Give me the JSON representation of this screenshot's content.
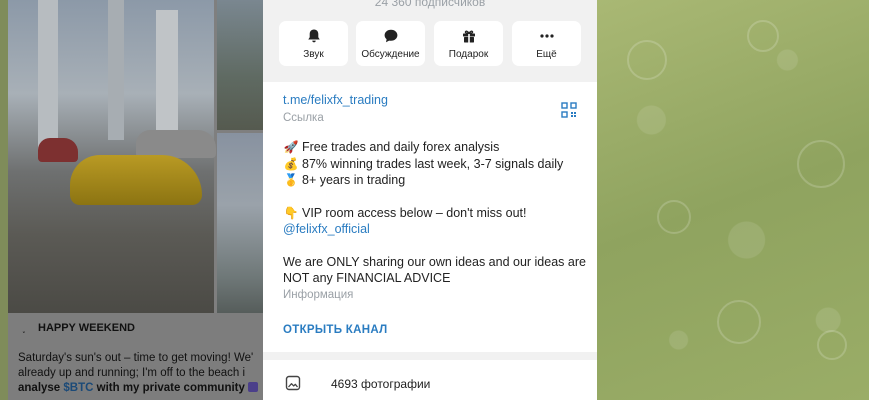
{
  "channel": {
    "subscribers": "24 360 подписчиков",
    "actions": [
      {
        "label": "Звук",
        "icon": "bell-icon"
      },
      {
        "label": "Обсуждение",
        "icon": "chat-bubble-icon"
      },
      {
        "label": "Подарок",
        "icon": "gift-icon"
      },
      {
        "label": "Ещё",
        "icon": "more-dots-icon"
      }
    ],
    "link": "t.me/felixfx_trading",
    "link_caption": "Ссылка",
    "description": {
      "lines": [
        {
          "emoji": "🚀",
          "text": "Free trades and daily forex analysis"
        },
        {
          "emoji": "💰",
          "text": "87% winning trades last week, 3-7 signals daily"
        },
        {
          "emoji": "🥇",
          "text": "8+ years in trading"
        }
      ],
      "vip": {
        "emoji": "👇",
        "text": "VIP room access below – don't miss out!"
      },
      "mention": "@felixfx_official",
      "disclaimer_1": "We are ONLY sharing our own ideas and our ideas are",
      "disclaimer_2": "NOT any FINANCIAL ADVICE"
    },
    "info_caption": "Информация",
    "open_channel": "ОТКРЫТЬ КАНАЛ",
    "photos": "4693 фотографии"
  },
  "post": {
    "title": "HAPPY WEEKEND",
    "line1": "Saturday's sun's out – time to get moving! We'",
    "line2": "already up and running; I'm off to the beach i",
    "line3_pre": "analyse ",
    "line3_ticker": "$BTC",
    "line3_post": " with my private community"
  },
  "colors": {
    "accent": "#2a7cc1",
    "muted": "#9aa0a6",
    "wallpaper": "#9fae6c"
  }
}
